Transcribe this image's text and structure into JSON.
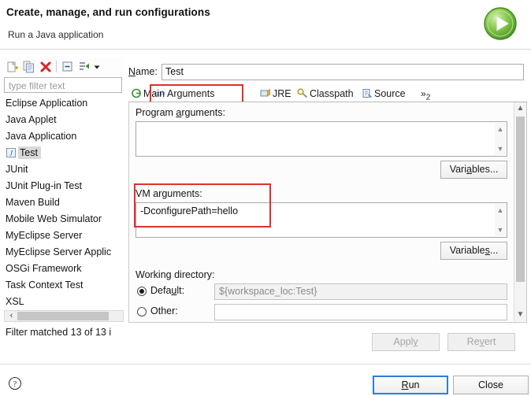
{
  "header": {
    "title": "Create, manage, and run configurations",
    "subtitle": "Run a Java application",
    "icon": "run-green-play-icon"
  },
  "left_panel": {
    "toolbar": [
      {
        "name": "new-configuration-icon",
        "label": "New launch configuration"
      },
      {
        "name": "duplicate-configuration-icon",
        "label": "Duplicate"
      },
      {
        "name": "delete-configuration-icon",
        "label": "Delete"
      },
      {
        "name": "collapse-all-icon",
        "label": "Collapse All"
      },
      {
        "name": "filter-configurations-icon",
        "label": "Filter launch configurations"
      },
      {
        "name": "chevron-down-icon",
        "label": "View Menu"
      }
    ],
    "filter": {
      "placeholder": "type filter text",
      "value": ""
    },
    "items": [
      {
        "label": "Eclipse Application",
        "icon": "",
        "selected": false
      },
      {
        "label": "Java Applet",
        "icon": "",
        "selected": false
      },
      {
        "label": "Java Application",
        "icon": "",
        "selected": false
      },
      {
        "label": "Test",
        "icon": "java-class-icon",
        "selected": true
      },
      {
        "label": "JUnit",
        "icon": "",
        "selected": false
      },
      {
        "label": "JUnit Plug-in Test",
        "icon": "",
        "selected": false
      },
      {
        "label": "Maven Build",
        "icon": "",
        "selected": false
      },
      {
        "label": "Mobile Web Simulator",
        "icon": "",
        "selected": false
      },
      {
        "label": "MyEclipse Server",
        "icon": "",
        "selected": false
      },
      {
        "label": "MyEclipse Server Applic",
        "icon": "",
        "selected": false
      },
      {
        "label": "OSGi Framework",
        "icon": "",
        "selected": false
      },
      {
        "label": "Task Context Test",
        "icon": "",
        "selected": false
      },
      {
        "label": "XSL",
        "icon": "",
        "selected": false
      }
    ],
    "status": "Filter matched 13 of 13 i"
  },
  "main": {
    "name_label": "Name:",
    "name_label_mnemonic": "N",
    "name_value": "Test",
    "tabs": [
      {
        "label": "Main",
        "icon": "main-tab-icon",
        "active": false,
        "highlighted": false
      },
      {
        "label": "Arguments",
        "icon": "arguments-tab-icon",
        "active": true,
        "highlighted": true
      },
      {
        "label": "JRE",
        "icon": "jre-tab-icon",
        "active": false,
        "highlighted": false
      },
      {
        "label": "Classpath",
        "icon": "classpath-tab-icon",
        "active": false,
        "highlighted": false
      },
      {
        "label": "Source",
        "icon": "source-tab-icon",
        "active": false,
        "highlighted": false
      }
    ],
    "tab_overflow": "»",
    "tab_overflow_count": "2",
    "program_arguments": {
      "label": "Program arguments:",
      "label_mnemonic": "a",
      "value": "",
      "variables_button": "Variables...",
      "variables_mnemonic": "a"
    },
    "vm_arguments": {
      "label": "VM arguments:",
      "value": "-DconfigurePath=hello",
      "variables_button": "Variables...",
      "variables_mnemonic": "s",
      "highlighted": true
    },
    "working_directory": {
      "label": "Working directory:",
      "default_radio_label": "Default:",
      "default_radio_mnemonic": "u",
      "default_radio_checked": true,
      "default_value": "${workspace_loc:Test}",
      "other_radio_label": "Other:",
      "other_radio_checked": false
    },
    "apply_button": "Apply",
    "apply_mnemonic": "y",
    "apply_enabled": false,
    "revert_button": "Revert",
    "revert_mnemonic": "v",
    "revert_enabled": false
  },
  "footer": {
    "help_icon": "help-question-icon",
    "run_button": "Run",
    "run_mnemonic": "R",
    "close_button": "Close"
  },
  "colors": {
    "highlight_red": "#e03030",
    "focus_blue": "#2a7fd4",
    "run_green": "#6cbb3c",
    "selection_grey": "#d9d9d9"
  }
}
